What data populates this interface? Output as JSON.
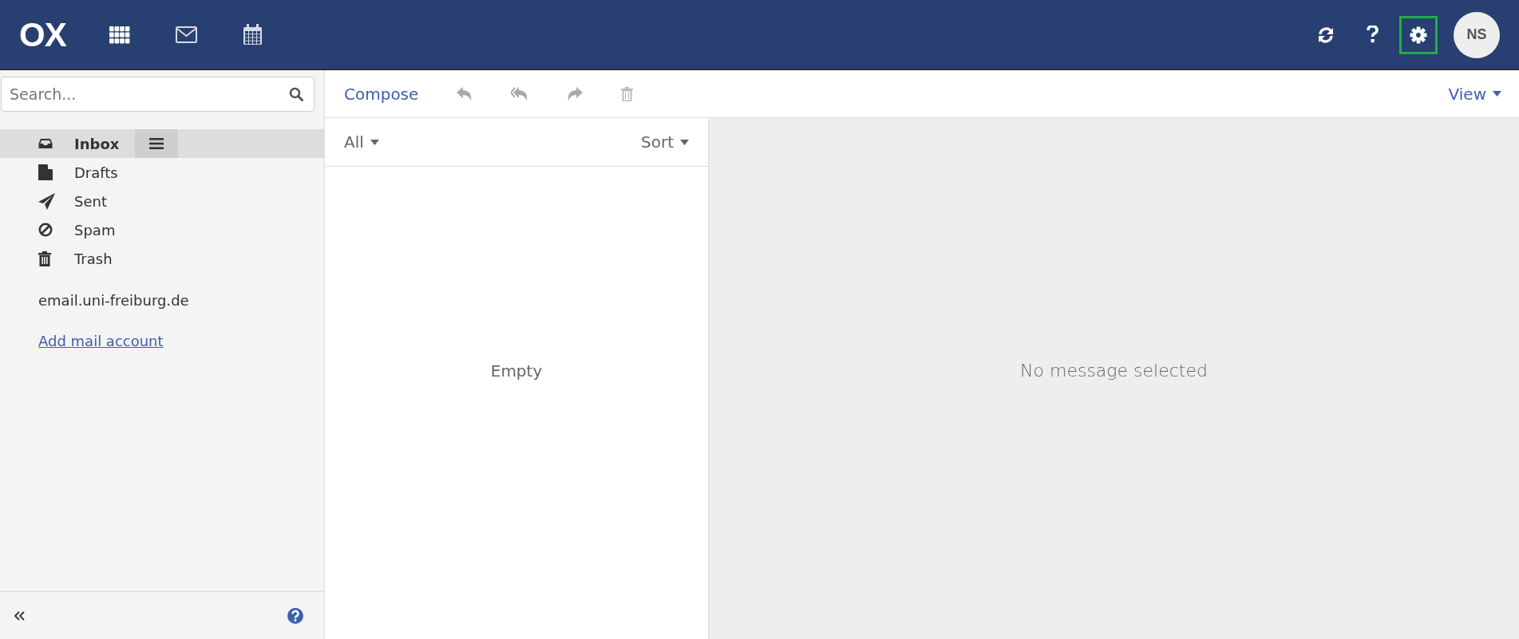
{
  "header": {
    "logo": "OX",
    "apps": [
      {
        "kind": "grid"
      },
      {
        "kind": "mail"
      },
      {
        "kind": "calendar"
      }
    ],
    "actions": [
      {
        "kind": "refresh",
        "highlighted": false
      },
      {
        "kind": "help",
        "highlighted": false
      },
      {
        "kind": "settings",
        "highlighted": true
      }
    ],
    "avatar": "NS"
  },
  "sidebar": {
    "search": {
      "placeholder": "Search..."
    },
    "folders": [
      {
        "kind": "inbox",
        "label": "Inbox",
        "selected": true
      },
      {
        "kind": "drafts",
        "label": "Drafts",
        "selected": false
      },
      {
        "kind": "sent",
        "label": "Sent",
        "selected": false
      },
      {
        "kind": "spam",
        "label": "Spam",
        "selected": false
      },
      {
        "kind": "trash",
        "label": "Trash",
        "selected": false
      }
    ],
    "account": "email.uni-freiburg.de",
    "add_account": "Add mail account"
  },
  "toolbar": {
    "compose": "Compose",
    "actions": [
      {
        "kind": "reply"
      },
      {
        "kind": "reply-all"
      },
      {
        "kind": "forward"
      },
      {
        "kind": "delete"
      }
    ],
    "view": "View"
  },
  "list": {
    "filter": "All",
    "sort": "Sort",
    "empty": "Empty"
  },
  "detail": {
    "message": "No message selected"
  }
}
